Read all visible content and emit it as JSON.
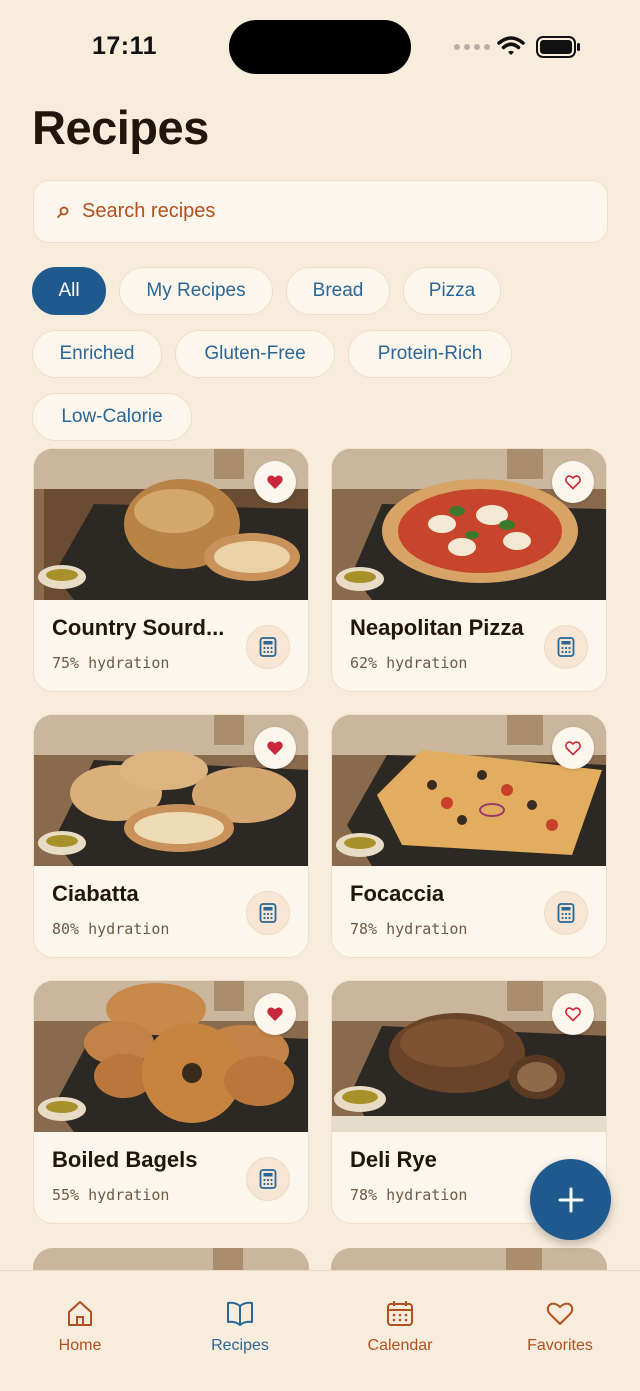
{
  "status_bar": {
    "time": "17:11"
  },
  "page": {
    "title": "Recipes"
  },
  "search": {
    "placeholder": "Search recipes"
  },
  "filters": [
    {
      "label": "All",
      "active": true
    },
    {
      "label": "My Recipes",
      "active": false
    },
    {
      "label": "Bread",
      "active": false
    },
    {
      "label": "Pizza",
      "active": false
    },
    {
      "label": "Enriched",
      "active": false
    },
    {
      "label": "Gluten-Free",
      "active": false
    },
    {
      "label": "Protein-Rich",
      "active": false
    },
    {
      "label": "Low-Calorie",
      "active": false
    }
  ],
  "recipes": [
    {
      "title": "Country Sourd...",
      "subtitle": "75% hydration",
      "favorite": true,
      "image": "sourdough-loaf"
    },
    {
      "title": "Neapolitan Pizza",
      "subtitle": "62% hydration",
      "favorite": false,
      "image": "pizza"
    },
    {
      "title": "Ciabatta",
      "subtitle": "80% hydration",
      "favorite": true,
      "image": "ciabatta"
    },
    {
      "title": "Focaccia",
      "subtitle": "78% hydration",
      "favorite": false,
      "image": "focaccia"
    },
    {
      "title": "Boiled Bagels",
      "subtitle": "55% hydration",
      "favorite": true,
      "image": "bagels"
    },
    {
      "title": "Deli Rye",
      "subtitle": "78% hydration",
      "favorite": false,
      "image": "rye-loaf"
    }
  ],
  "nav": [
    {
      "label": "Home",
      "icon": "home-icon",
      "active": false
    },
    {
      "label": "Recipes",
      "icon": "book-icon",
      "active": true
    },
    {
      "label": "Calendar",
      "icon": "calendar-icon",
      "active": false
    },
    {
      "label": "Favorites",
      "icon": "heart-icon",
      "active": false
    }
  ],
  "colors": {
    "accent": "#1f5a8e",
    "background": "#f8ecdc",
    "link": "#b2501f",
    "favorite": "#c8283a"
  }
}
